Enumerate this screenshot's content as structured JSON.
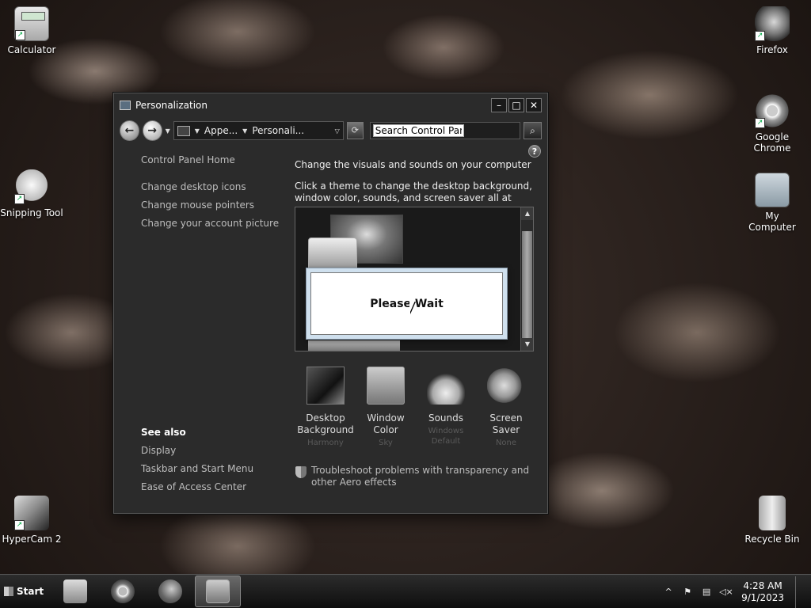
{
  "desktop": {
    "icons": [
      {
        "label": "Calculator"
      },
      {
        "label": "Snipping Tool"
      },
      {
        "label": "HyperCam 2"
      },
      {
        "label": "Firefox"
      },
      {
        "label": "Google Chrome"
      },
      {
        "label": "My Computer"
      },
      {
        "label": "Recycle Bin"
      }
    ]
  },
  "window": {
    "title": "Personalization",
    "controls": {
      "minimize": "–",
      "maximize": "□",
      "close": "✕"
    },
    "address": {
      "crumbs": [
        "Appe...",
        "Personali..."
      ],
      "search_value": "Search Control Panel"
    },
    "left_links": {
      "home": "Control Panel Home",
      "items": [
        "Change desktop icons",
        "Change mouse pointers",
        "Change your account picture"
      ]
    },
    "see_also": {
      "heading": "See also",
      "items": [
        "Display",
        "Taskbar and Start Menu",
        "Ease of Access Center"
      ]
    },
    "main": {
      "heading": "Change the visuals and sounds on your computer",
      "description": "Click a theme to change the desktop background, window color, sounds, and screen saver all at once."
    },
    "wait_dialog": {
      "text": "Please Wait"
    },
    "tiles": [
      {
        "label": "Desktop Background",
        "sub": "Harmony"
      },
      {
        "label": "Window Color",
        "sub": "Sky"
      },
      {
        "label": "Sounds",
        "sub": "Windows Default"
      },
      {
        "label": "Screen Saver",
        "sub": "None"
      }
    ],
    "troubleshoot": "Troubleshoot problems with transparency and other Aero effects"
  },
  "taskbar": {
    "start_label": "Start",
    "time": "4:28 AM",
    "date": "9/1/2023"
  }
}
